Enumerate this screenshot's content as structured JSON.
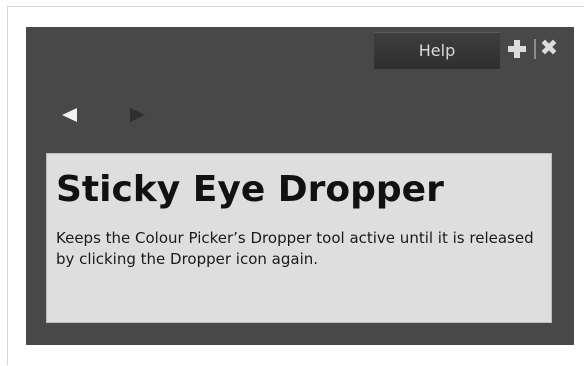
{
  "panel": {
    "help_tab_label": "Help",
    "add_icon": "plus-icon",
    "close_icon": "close-icon",
    "close_glyph": "✖"
  },
  "nav": {
    "back_icon": "arrow-left-icon",
    "forward_icon": "arrow-right-icon"
  },
  "content": {
    "title": "Sticky Eye Dropper",
    "description": "Keeps the Colour Picker’s Dropper tool active until it is released by clicking the Dropper icon again."
  },
  "colors": {
    "panel_bg": "#484848",
    "content_bg": "#dedede",
    "tab_bg": "#333333",
    "text_dark": "#111111",
    "icon_light": "#dcdcdc"
  }
}
